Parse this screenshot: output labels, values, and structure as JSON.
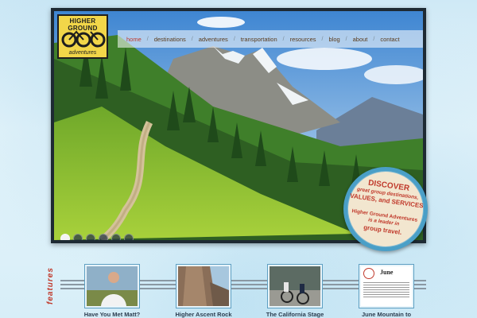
{
  "nav": {
    "items": [
      {
        "label": "home",
        "active": true
      },
      {
        "label": "destinations",
        "active": false
      },
      {
        "label": "adventures",
        "active": false
      },
      {
        "label": "transportation",
        "active": false
      },
      {
        "label": "resources",
        "active": false
      },
      {
        "label": "blog",
        "active": false
      },
      {
        "label": "about",
        "active": false
      },
      {
        "label": "contact",
        "active": false
      }
    ],
    "separator": "/"
  },
  "logo": {
    "line1": "HIGHER GROUND",
    "line2": "adventures"
  },
  "slideshow": {
    "dot_count": 6,
    "active_index": 0
  },
  "badge": {
    "line1": "DISCOVER",
    "line2": "great group destinations,",
    "line3": "VALUES, and SERVICES",
    "line4": "Higher Ground Adventures",
    "line5": "is a leader in",
    "line6": "group travel."
  },
  "features": {
    "label": "features",
    "items": [
      {
        "caption": "Have You Met Matt?"
      },
      {
        "caption": "Higher Ascent Rock"
      },
      {
        "caption": "The California Stage"
      },
      {
        "caption": "June Mountain to",
        "thumb_title": "June"
      }
    ]
  },
  "colors": {
    "accent": "#c0392b",
    "frame": "#1e2a33",
    "badge_ring": "#4a9fc7",
    "logo_bg": "#f2d649"
  }
}
